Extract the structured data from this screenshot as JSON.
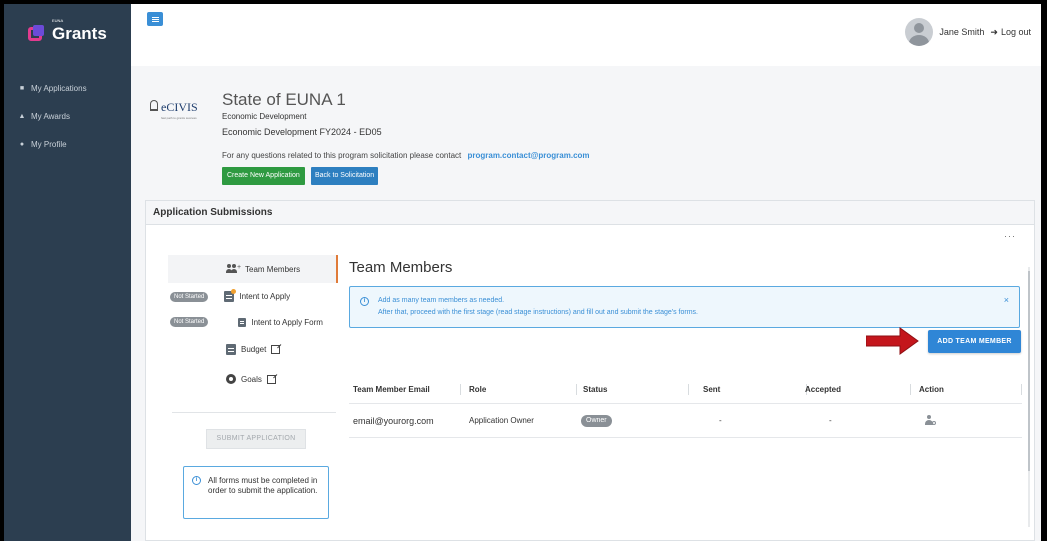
{
  "brand": {
    "small": "EUNA",
    "name": "Grants"
  },
  "sidebar": {
    "items": [
      {
        "icon": "home-icon",
        "label": "My Applications"
      },
      {
        "icon": "trophy-icon",
        "label": "My Awards"
      },
      {
        "icon": "user-icon",
        "label": "My Profile"
      }
    ]
  },
  "topbar": {
    "user_name": "Jane Smith",
    "logout_label": "Log out"
  },
  "header": {
    "logo_text": "eCIVIS",
    "logo_tag": "fast path to grants success",
    "title": "State of EUNA 1",
    "department": "Economic Development",
    "program": "Economic Development FY2024 - ED05",
    "contact_text": "For any questions related to this program solicitation please contact",
    "contact_email": "program.contact@program.com",
    "create_button": "Create New Application",
    "back_button": "Back to Solicitation"
  },
  "panel": {
    "title": "Application Submissions",
    "more": "···",
    "stages": [
      {
        "label": "Team Members",
        "status": ""
      },
      {
        "label": "Intent to Apply",
        "status": "Not Started"
      },
      {
        "label": "Intent to Apply Form",
        "status": "Not Started"
      },
      {
        "label": "Budget",
        "status": ""
      },
      {
        "label": "Goals",
        "status": ""
      }
    ],
    "submit_button": "SUBMIT APPLICATION",
    "info_text": "All forms must be completed in order to submit the application."
  },
  "content": {
    "title": "Team Members",
    "alert_line1": "Add as many team members as needed.",
    "alert_line2": "After that, proceed with the first stage (read stage instructions) and fill out and submit the stage's forms.",
    "alert_close": "×",
    "add_button": "ADD TEAM MEMBER",
    "table": {
      "headers": [
        "Team Member Email",
        "Role",
        "Status",
        "Sent",
        "Accepted",
        "Action"
      ],
      "rows": [
        {
          "email": "email@yourorg.com",
          "role": "Application Owner",
          "status": "Owner",
          "sent": "-",
          "accepted": "-"
        }
      ]
    }
  },
  "colors": {
    "sidebar": "#2c3e50",
    "primary": "#2f86d6",
    "success": "#2e9a41",
    "accent": "#e07b39",
    "arrow": "#c4161c"
  }
}
